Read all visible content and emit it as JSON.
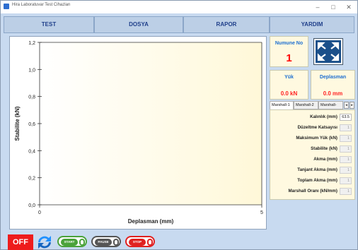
{
  "window": {
    "title": "Hira Laboratuvar Test Cihazları"
  },
  "menu": [
    "TEST",
    "DOSYA",
    "RAPOR",
    "YARDIM"
  ],
  "chart_data": {
    "type": "line",
    "xlabel": "Deplasman (mm)",
    "ylabel": "Stabilite (kN)",
    "xlim": [
      0,
      5
    ],
    "ylim": [
      0,
      1.2
    ],
    "x_ticks": [
      "0",
      "5"
    ],
    "y_ticks": [
      "0,0",
      "0,2",
      "0,4",
      "0,6",
      "0,8",
      "1,0",
      "1,2"
    ],
    "series": []
  },
  "sample": {
    "title": "Numune No",
    "value": "1"
  },
  "load": {
    "title": "Yük",
    "value": "0.0 kN"
  },
  "displacement": {
    "title": "Deplasman",
    "value": "0.0 mm"
  },
  "tabs": [
    "Marshall-1",
    "Marshall-2",
    "Marshall-"
  ],
  "params": [
    {
      "label": "Kalınlık (mm)",
      "value": "63.5",
      "editable": true
    },
    {
      "label": "Düzeltme Katsayısı",
      "value": "1"
    },
    {
      "label": "Maksimum Yük (kN)",
      "value": "1"
    },
    {
      "label": "Stabilite (kN)",
      "value": "1"
    },
    {
      "label": "Akma (mm)",
      "value": "1"
    },
    {
      "label": "Tanjant Akma (mm)",
      "value": "1"
    },
    {
      "label": "Toplam Akma (mm)",
      "value": "1"
    },
    {
      "label": "Marshall Oranı (kN/mm)",
      "value": "1"
    }
  ],
  "controls": {
    "off": "OFF",
    "start": "START",
    "pause": "PAUSE",
    "stop": "STOP"
  },
  "colors": {
    "accent": "#1d6fd0",
    "alert": "#ff0000",
    "start": "#4aa23a",
    "pause": "#555555",
    "stop": "#e02020"
  }
}
